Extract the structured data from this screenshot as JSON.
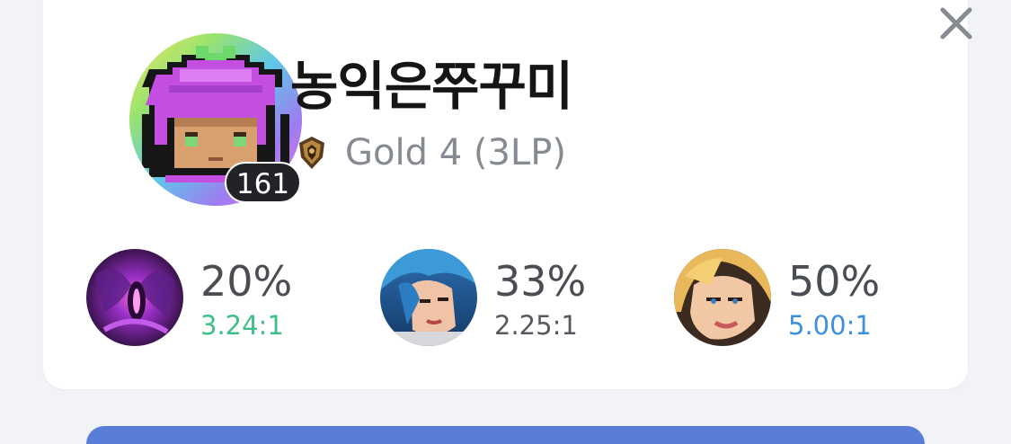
{
  "profile": {
    "name": "농익은쭈꾸미",
    "level": "161",
    "rank": "Gold 4 (3LP)"
  },
  "icons": {
    "close": "close-icon",
    "avatar": "profile-avatar-icon",
    "rank": "gold-rank-emblem-icon"
  },
  "champions": [
    {
      "winrate": "20%",
      "kda": "3.24:1",
      "kda_color": "#3fbf8a",
      "icon": "champion-purple-void-icon"
    },
    {
      "winrate": "33%",
      "kda": "2.25:1",
      "kda_color": "#555a60",
      "icon": "champion-blue-hair-icon"
    },
    {
      "winrate": "50%",
      "kda": "5.00:1",
      "kda_color": "#3d8fde",
      "icon": "champion-blonde-icon"
    }
  ],
  "colors": {
    "background": "#f2f3f6",
    "card": "#ffffff",
    "name": "#151515",
    "rank_text": "#868a91",
    "level_badge": "#222326",
    "accent_blue": "#5a7ed8"
  }
}
